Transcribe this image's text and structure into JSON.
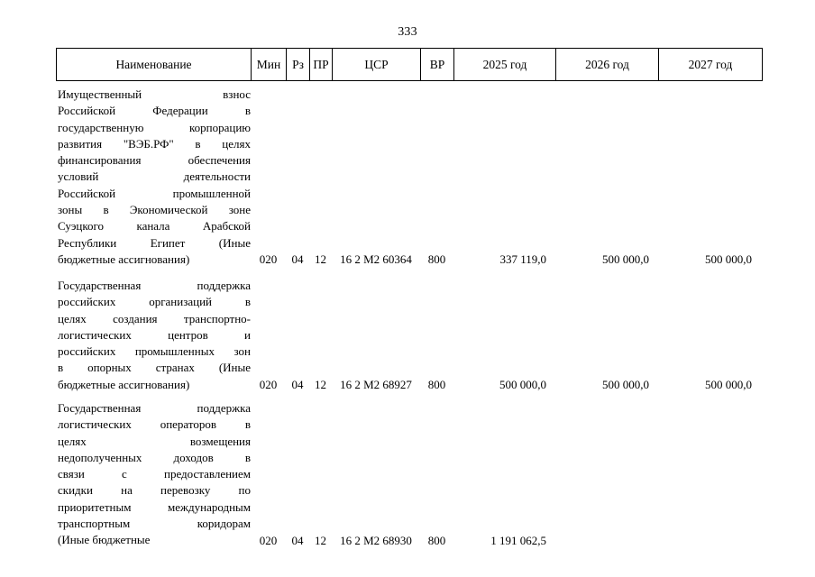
{
  "page": {
    "number": "333"
  },
  "table": {
    "headers": [
      {
        "key": "name",
        "label": "Наименование"
      },
      {
        "key": "min",
        "label": "Мин"
      },
      {
        "key": "rz",
        "label": "Рз"
      },
      {
        "key": "pr",
        "label": "ПР"
      },
      {
        "key": "csr",
        "label": "ЦСР"
      },
      {
        "key": "vr",
        "label": "ВР"
      },
      {
        "key": "y1",
        "label": "2025 год"
      },
      {
        "key": "y2",
        "label": "2026 год"
      },
      {
        "key": "y3",
        "label": "2027 год"
      }
    ],
    "rows": [
      {
        "name_lines": [
          "Имущественный взнос",
          "Российской Федерации в",
          "государственную корпорацию",
          "развития \"ВЭБ.РФ\" в целях",
          "финансирования обеспечения",
          "условий деятельности",
          "Российской промышленной",
          "зоны в Экономической зоне",
          "Суэцкого канала Арабской",
          "Республики Египет (Иные",
          "бюджетные ассигнования)"
        ],
        "min": "020",
        "rz": "04",
        "pr": "12",
        "csr": "16 2 М2 60364",
        "vr": "800",
        "y1": "337 119,0",
        "y2": "500 000,0",
        "y3": "500 000,0"
      },
      {
        "name_lines": [
          "Государственная поддержка",
          "российских организаций в",
          "целях создания транспортно-",
          "логистических центров и",
          "российских промышленных зон",
          "в опорных странах (Иные",
          "бюджетные ассигнования)"
        ],
        "min": "020",
        "rz": "04",
        "pr": "12",
        "csr": "16 2 М2 68927",
        "vr": "800",
        "y1": "500 000,0",
        "y2": "500 000,0",
        "y3": "500 000,0"
      },
      {
        "name_lines": [
          "Государственная поддержка",
          "логистических операторов в",
          "целях возмещения",
          "недополученных доходов в",
          "связи с предоставлением",
          "скидки на перевозку по",
          "приоритетным международным",
          "транспортным коридорам",
          "(Иные бюджетные"
        ],
        "min": "020",
        "rz": "04",
        "pr": "12",
        "csr": "16 2 М2 68930",
        "vr": "800",
        "y1": "1 191 062,5",
        "y2": "",
        "y3": ""
      }
    ]
  }
}
